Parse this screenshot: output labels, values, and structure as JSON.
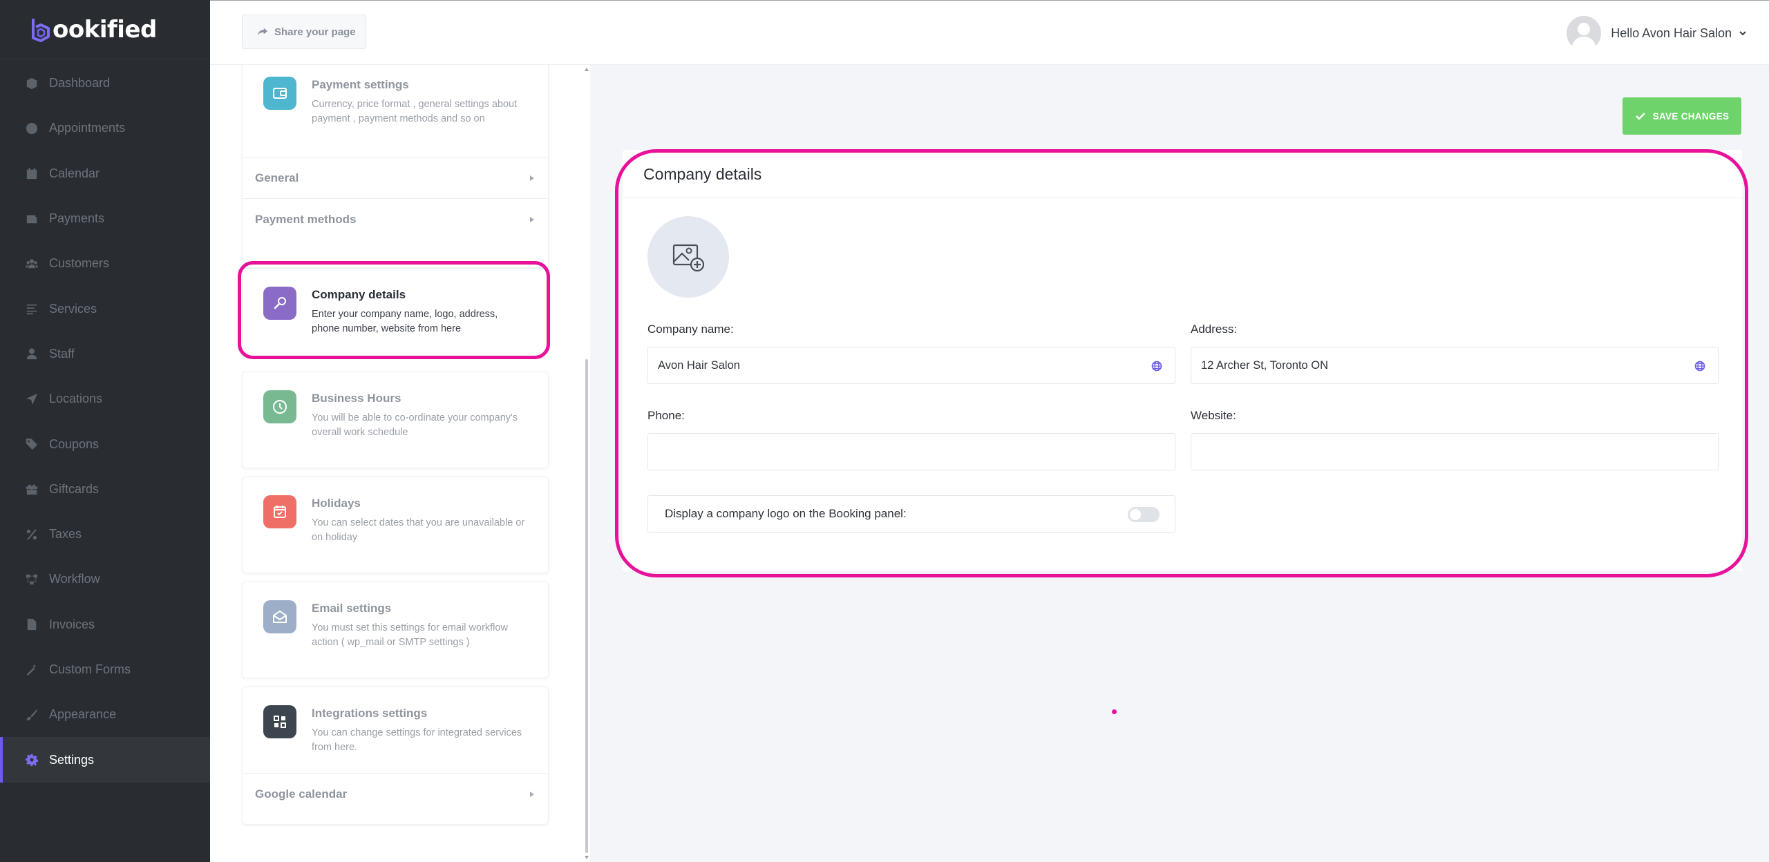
{
  "app": {
    "brand": "ookified",
    "brand_letter": "b",
    "accent_color": "#6c5ce7",
    "highlight_color": "#e8129a"
  },
  "sidebar": {
    "items": [
      {
        "label": "Dashboard",
        "icon": "cube-icon"
      },
      {
        "label": "Appointments",
        "icon": "clock-icon"
      },
      {
        "label": "Calendar",
        "icon": "calendar-icon"
      },
      {
        "label": "Payments",
        "icon": "wallet-icon"
      },
      {
        "label": "Customers",
        "icon": "users-icon"
      },
      {
        "label": "Services",
        "icon": "list-icon"
      },
      {
        "label": "Staff",
        "icon": "user-icon"
      },
      {
        "label": "Locations",
        "icon": "location-arrow-icon"
      },
      {
        "label": "Coupons",
        "icon": "tag-icon"
      },
      {
        "label": "Giftcards",
        "icon": "gift-icon"
      },
      {
        "label": "Taxes",
        "icon": "percent-icon"
      },
      {
        "label": "Workflow",
        "icon": "workflow-icon"
      },
      {
        "label": "Invoices",
        "icon": "file-icon"
      },
      {
        "label": "Custom Forms",
        "icon": "magic-wand-icon"
      },
      {
        "label": "Appearance",
        "icon": "brush-icon"
      },
      {
        "label": "Settings",
        "icon": "gear-icon",
        "active": true
      }
    ]
  },
  "topbar": {
    "share_label": "Share your page",
    "user_greeting": "Hello Avon Hair Salon"
  },
  "settings_list": {
    "payment": {
      "title": "Payment settings",
      "description": "Currency, price format , general settings about payment , payment methods and so on",
      "sub_items": [
        "General",
        "Payment methods"
      ]
    },
    "company": {
      "title": "Company details",
      "description": "Enter your company name, logo, address, phone number, website from here"
    },
    "business_hours": {
      "title": "Business Hours",
      "description": "You will be able to co-ordinate your company's overall work schedule"
    },
    "holidays": {
      "title": "Holidays",
      "description": "You can select dates that you are unavailable or on holiday"
    },
    "email": {
      "title": "Email settings",
      "description": "You must set this settings for email workflow action ( wp_mail or SMTP settings )"
    },
    "integrations": {
      "title": "Integrations settings",
      "description": "You can change settings for integrated services from here.",
      "sub_items": [
        "Google calendar"
      ]
    }
  },
  "main": {
    "save_label": "SAVE CHANGES",
    "section_title": "Company details",
    "fields": {
      "company_name_label": "Company name:",
      "company_name_value": "Avon Hair Salon",
      "address_label": "Address:",
      "address_value": "12 Archer St, Toronto ON",
      "phone_label": "Phone:",
      "phone_value": "",
      "website_label": "Website:",
      "website_value": ""
    },
    "toggle_label": "Display a company logo on the Booking panel:",
    "toggle_on": false
  }
}
